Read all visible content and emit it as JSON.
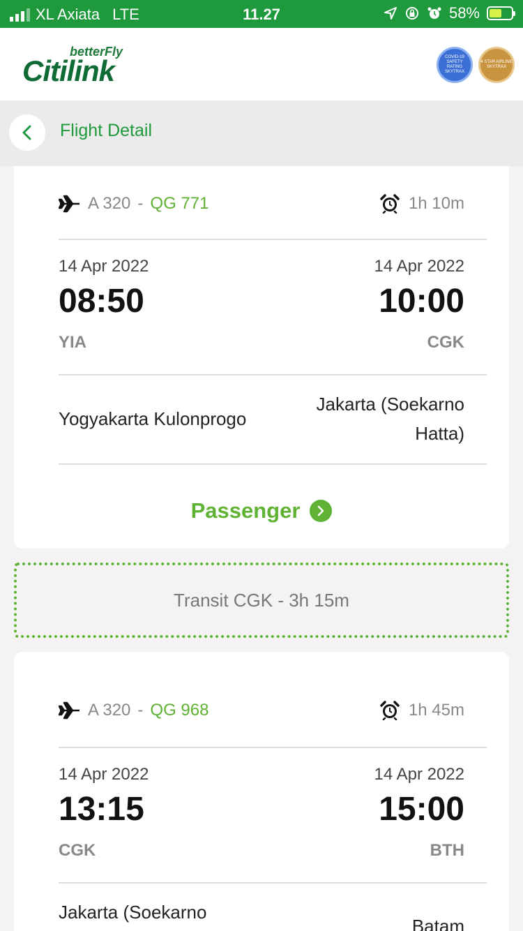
{
  "status_bar": {
    "carrier": "XL Axiata",
    "network": "LTE",
    "time": "11.27",
    "battery": "58%"
  },
  "header": {
    "logo_tagline": "betterFly",
    "logo_name": "Citilink",
    "badge_covid": "COVID-19 SAFETY RATING SKYTRAX",
    "badge_star": "4 STAR AIRLINE SKYTRAX"
  },
  "titlebar": {
    "title": "Flight Detail"
  },
  "flights": [
    {
      "aircraft": "A 320",
      "separator": "-",
      "flight_no": "QG 771",
      "duration": "1h 10m",
      "depart_date": "14 Apr 2022",
      "depart_time": "08:50",
      "depart_code": "YIA",
      "arrive_date": "14 Apr 2022",
      "arrive_time": "10:00",
      "arrive_code": "CGK",
      "depart_city": "Yogyakarta Kulonprogo",
      "arrive_city_line1": "Jakarta (Soekarno",
      "arrive_city_line2": "Hatta)",
      "passenger_label": "Passenger"
    },
    {
      "aircraft": "A 320",
      "separator": "-",
      "flight_no": "QG 968",
      "duration": "1h 45m",
      "depart_date": "14 Apr 2022",
      "depart_time": "13:15",
      "depart_code": "CGK",
      "arrive_date": "14 Apr 2022",
      "arrive_time": "15:00",
      "arrive_code": "BTH",
      "depart_city_line1": "Jakarta (Soekarno",
      "arrive_city": "Batam"
    }
  ],
  "transit": {
    "text": "Transit CGK - 3h 15m"
  },
  "colors": {
    "brand_green": "#1e9a3c",
    "accent_green": "#5fb233"
  },
  "icons": [
    "plane-icon",
    "alarm-clock-icon",
    "chevron-left-icon",
    "chevron-right-icon"
  ]
}
